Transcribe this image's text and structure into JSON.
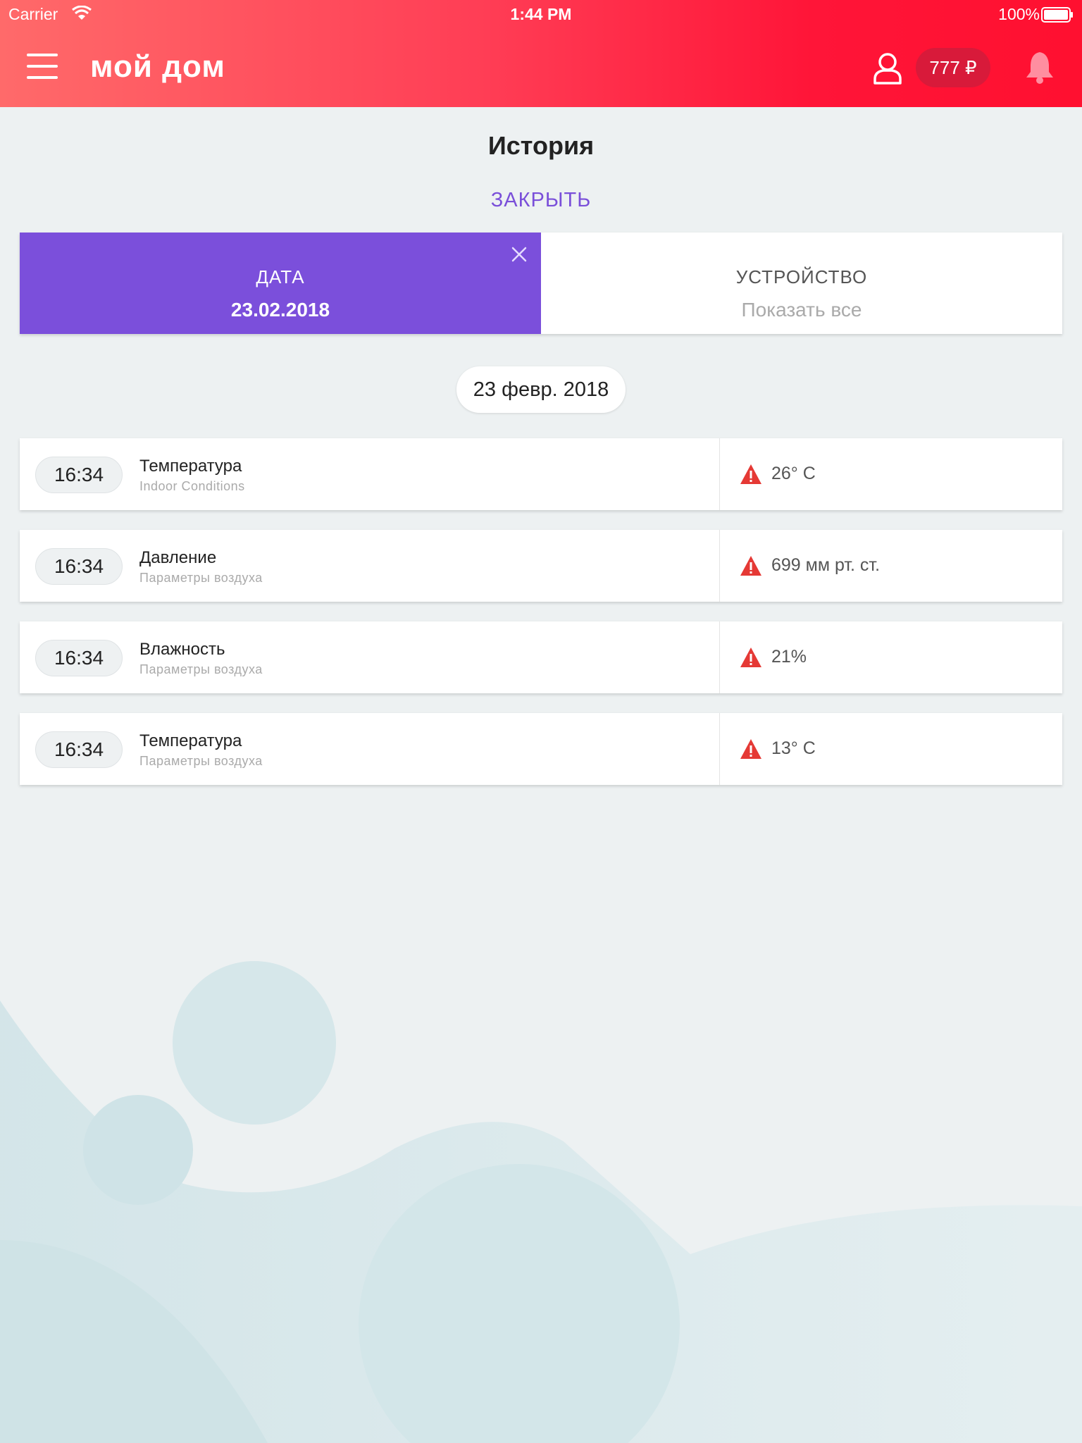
{
  "status_bar": {
    "carrier": "Carrier",
    "time": "1:44 PM",
    "battery": "100%"
  },
  "header": {
    "logo": "мой дом",
    "balance": "777 ₽",
    "icons": [
      "menu-icon",
      "user-icon",
      "bell-icon"
    ]
  },
  "page": {
    "title": "История",
    "close_label": "ЗАКРЫТЬ"
  },
  "filters": {
    "date": {
      "label": "ДАТА",
      "value": "23.02.2018"
    },
    "device": {
      "label": "УСТРОЙСТВО",
      "value": "Показать все"
    }
  },
  "date_group": "23 февр. 2018",
  "history": [
    {
      "time": "16:34",
      "title": "Температура",
      "subtitle": "Indoor Conditions",
      "value": "26° C"
    },
    {
      "time": "16:34",
      "title": "Давление",
      "subtitle": "Параметры воздуха",
      "value": "699 мм рт. ст."
    },
    {
      "time": "16:34",
      "title": "Влажность",
      "subtitle": "Параметры воздуха",
      "value": "21%"
    },
    {
      "time": "16:34",
      "title": "Температура",
      "subtitle": "Параметры воздуха",
      "value": "13° C"
    }
  ],
  "colors": {
    "header_gradient_start": "#ff6a6a",
    "header_gradient_end": "#ff1030",
    "accent_purple": "#7b4fdb",
    "warning_red": "#e53935"
  }
}
